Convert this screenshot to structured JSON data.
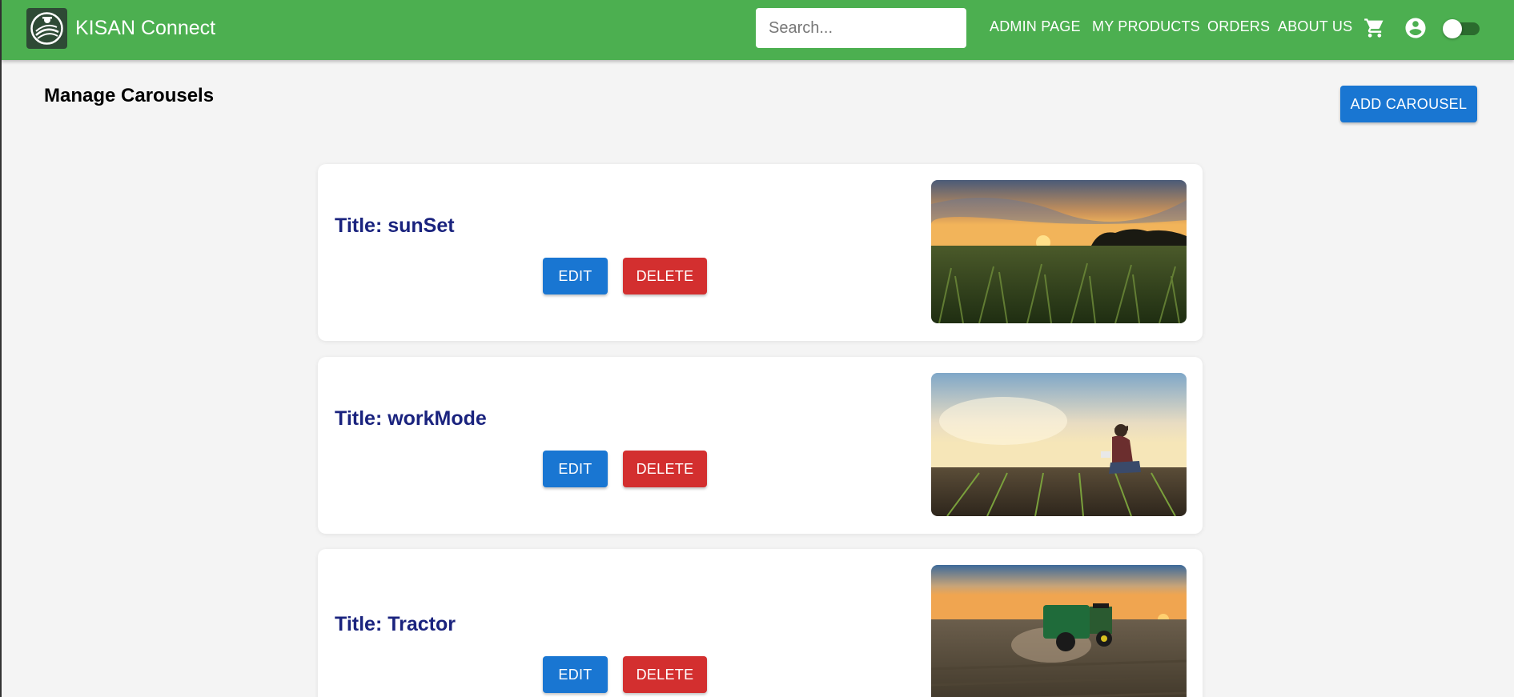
{
  "header": {
    "brand": "KISAN Connect",
    "search_placeholder": "Search...",
    "nav": [
      "ADMIN PAGE",
      "MY PRODUCTS",
      "ORDERS",
      "ABOUT US"
    ],
    "icons": [
      "cart-icon",
      "account-circle-icon"
    ],
    "theme_toggle_on": false,
    "colors": {
      "appbar": "#4caf50"
    }
  },
  "page": {
    "title": "Manage Carousels",
    "add_button": "ADD CAROUSEL"
  },
  "carousels": [
    {
      "title": "Title: sunSet",
      "edit": "EDIT",
      "delete": "DELETE",
      "image": "sunset-cornfield-image"
    },
    {
      "title": "Title: workMode",
      "edit": "EDIT",
      "delete": "DELETE",
      "image": "farmer-field-image"
    },
    {
      "title": "Title: Tractor",
      "edit": "EDIT",
      "delete": "DELETE",
      "image": "tractor-field-image"
    }
  ]
}
